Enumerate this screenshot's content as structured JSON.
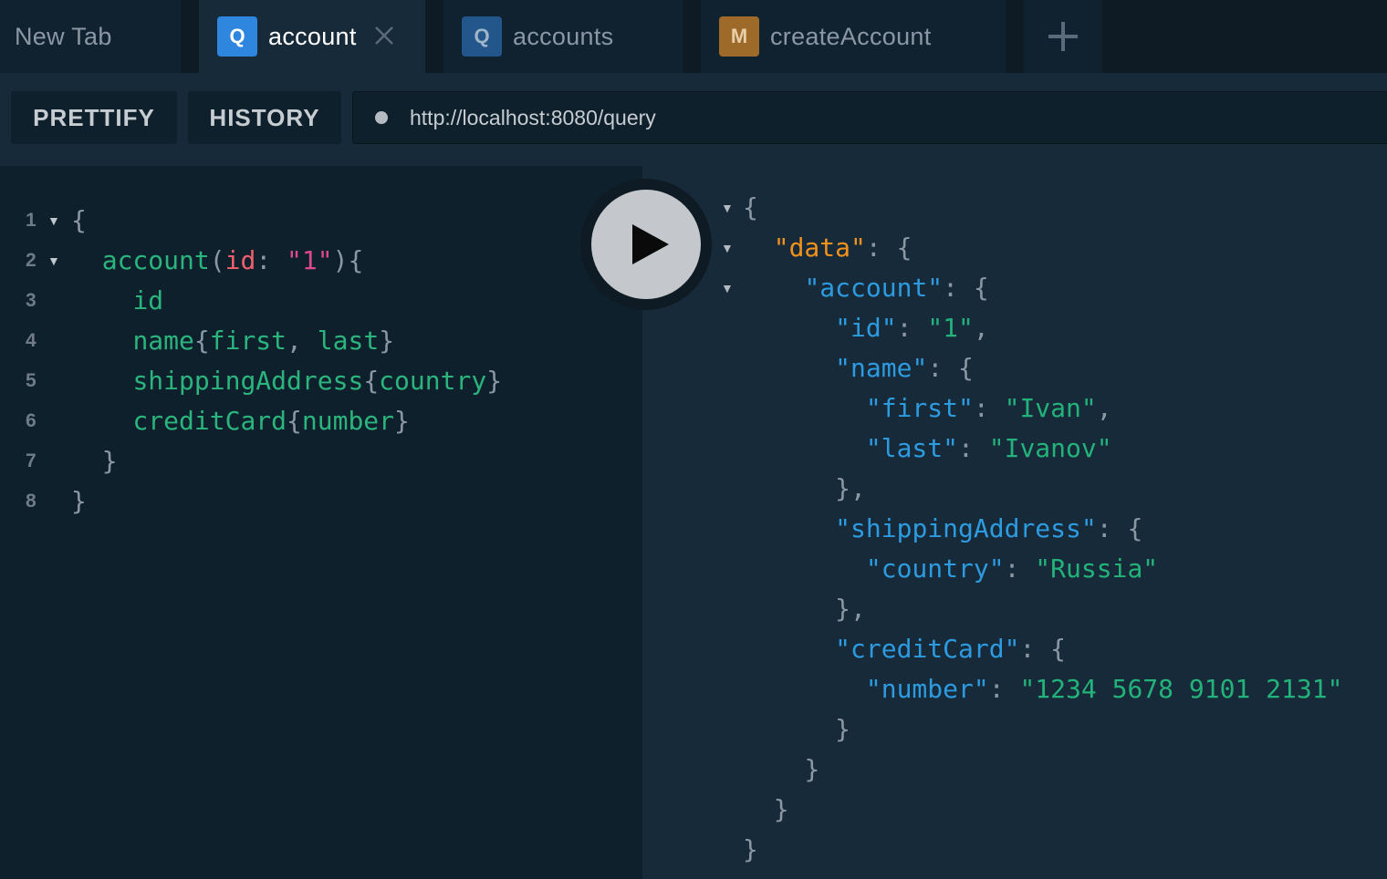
{
  "tabs": [
    {
      "label": "New Tab",
      "badge": ""
    },
    {
      "label": "account",
      "badge": "Q",
      "active": true
    },
    {
      "label": "accounts",
      "badge": "Q"
    },
    {
      "label": "createAccount",
      "badge": "M"
    }
  ],
  "toolbar": {
    "prettify_label": "PRETTIFY",
    "history_label": "HISTORY",
    "endpoint_url": "http://localhost:8080/query"
  },
  "query": {
    "line_numbers": [
      "1",
      "2",
      "3",
      "4",
      "5",
      "6",
      "7",
      "8"
    ],
    "lines": [
      [
        [
          "{",
          "punc"
        ]
      ],
      [
        [
          "account",
          "field"
        ],
        [
          "(",
          "punc"
        ],
        [
          "id",
          "arg"
        ],
        [
          ": ",
          "punc"
        ],
        [
          "\"1\"",
          "string"
        ],
        [
          "){",
          "punc"
        ]
      ],
      [
        [
          "id",
          "field"
        ]
      ],
      [
        [
          "name",
          "field"
        ],
        [
          "{",
          "punc"
        ],
        [
          "first",
          "field"
        ],
        [
          ", ",
          "punc"
        ],
        [
          "last",
          "field"
        ],
        [
          "}",
          "punc"
        ]
      ],
      [
        [
          "shippingAddress",
          "field"
        ],
        [
          "{",
          "punc"
        ],
        [
          "country",
          "field"
        ],
        [
          "}",
          "punc"
        ]
      ],
      [
        [
          "creditCard",
          "field"
        ],
        [
          "{",
          "punc"
        ],
        [
          "number",
          "field"
        ],
        [
          "}",
          "punc"
        ]
      ],
      [
        [
          "}",
          "punc"
        ]
      ],
      [
        [
          "}",
          "punc"
        ]
      ]
    ]
  },
  "response": {
    "lines": [
      [
        [
          "{",
          "punc"
        ]
      ],
      [
        [
          "\"data\"",
          "key-data"
        ],
        [
          ": {",
          "punc"
        ]
      ],
      [
        [
          "\"account\"",
          "key"
        ],
        [
          ": {",
          "punc"
        ]
      ],
      [
        [
          "\"id\"",
          "key"
        ],
        [
          ": ",
          "punc"
        ],
        [
          "\"1\"",
          "val"
        ],
        [
          ",",
          "punc"
        ]
      ],
      [
        [
          "\"name\"",
          "key"
        ],
        [
          ": {",
          "punc"
        ]
      ],
      [
        [
          "\"first\"",
          "key"
        ],
        [
          ": ",
          "punc"
        ],
        [
          "\"Ivan\"",
          "val"
        ],
        [
          ",",
          "punc"
        ]
      ],
      [
        [
          "\"last\"",
          "key"
        ],
        [
          ": ",
          "punc"
        ],
        [
          "\"Ivanov\"",
          "val"
        ]
      ],
      [
        [
          "},",
          "punc"
        ]
      ],
      [
        [
          "\"shippingAddress\"",
          "key"
        ],
        [
          ": {",
          "punc"
        ]
      ],
      [
        [
          "\"country\"",
          "key"
        ],
        [
          ": ",
          "punc"
        ],
        [
          "\"Russia\"",
          "val"
        ]
      ],
      [
        [
          "},",
          "punc"
        ]
      ],
      [
        [
          "\"creditCard\"",
          "key"
        ],
        [
          ": {",
          "punc"
        ]
      ],
      [
        [
          "\"number\"",
          "key"
        ],
        [
          ": ",
          "punc"
        ],
        [
          "\"1234 5678 9101 2131\"",
          "val"
        ]
      ],
      [
        [
          "}",
          "punc"
        ]
      ],
      [
        [
          "}",
          "punc"
        ]
      ],
      [
        [
          "}",
          "punc"
        ]
      ],
      [
        [
          "}",
          "punc"
        ]
      ]
    ]
  },
  "icons": {
    "tab_close": "close-icon",
    "add_tab": "plus-icon",
    "run": "play-icon",
    "fold": "triangle-down-icon"
  }
}
